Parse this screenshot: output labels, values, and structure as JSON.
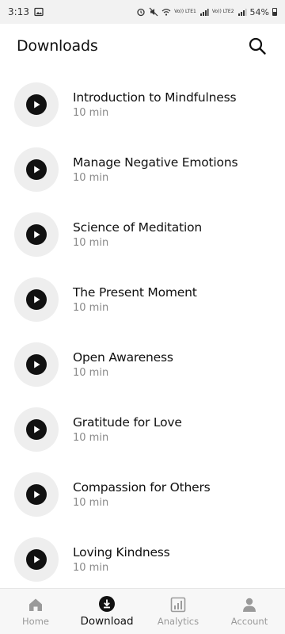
{
  "status_bar": {
    "time": "3:13",
    "battery": "54%",
    "network_1": "Vo)) LTE1",
    "network_2": "Vo)) LTE2"
  },
  "header": {
    "title": "Downloads",
    "search_icon": "search-icon"
  },
  "downloads": [
    {
      "title": "Introduction to Mindfulness",
      "duration": "10 min"
    },
    {
      "title": "Manage Negative Emotions",
      "duration": "10 min"
    },
    {
      "title": "Science of Meditation",
      "duration": "10 min"
    },
    {
      "title": "The Present Moment",
      "duration": "10 min"
    },
    {
      "title": "Open Awareness",
      "duration": "10 min"
    },
    {
      "title": "Gratitude for Love",
      "duration": "10 min"
    },
    {
      "title": "Compassion for Others",
      "duration": "10 min"
    },
    {
      "title": "Loving Kindness",
      "duration": "10 min"
    }
  ],
  "bottom_nav": [
    {
      "label": "Home",
      "icon": "home-icon",
      "active": false
    },
    {
      "label": "Download",
      "icon": "download-icon",
      "active": true
    },
    {
      "label": "Analytics",
      "icon": "analytics-icon",
      "active": false
    },
    {
      "label": "Account",
      "icon": "account-icon",
      "active": false
    }
  ],
  "colors": {
    "accent": "#111111",
    "muted": "#8a8a8a",
    "play_bg": "#eeeeee",
    "nav_bg": "#f7f7f7"
  }
}
